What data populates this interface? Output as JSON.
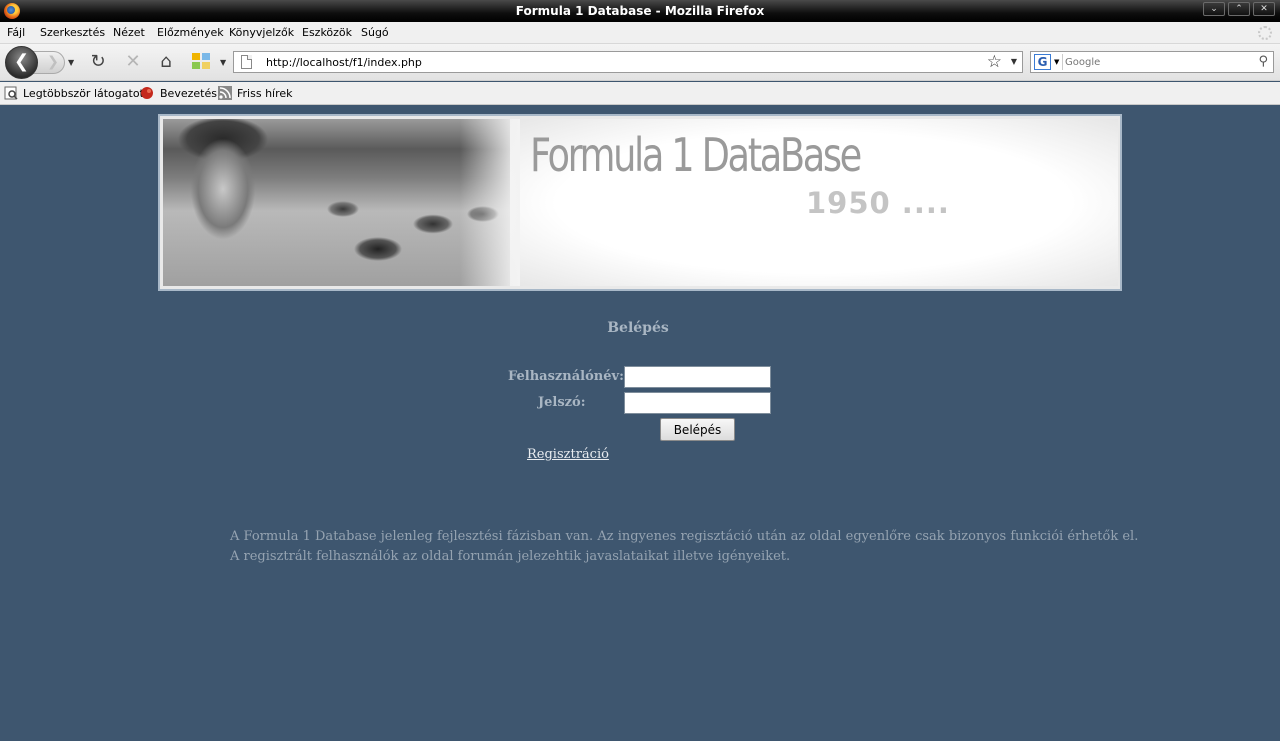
{
  "window": {
    "title": "Formula 1 Database - Mozilla Firefox",
    "controls": {
      "minimize": "⌄",
      "maximize": "⌃",
      "close": "✕"
    }
  },
  "menu": {
    "items": [
      "Fájl",
      "Szerkesztés",
      "Nézet",
      "Előzmények",
      "Könyvjelzők",
      "Eszközök",
      "Súgó"
    ]
  },
  "navigation": {
    "back_icon": "back-arrow-icon",
    "forward_icon": "forward-arrow-icon",
    "url": "http://localhost/f1/index.php",
    "search_placeholder": "Google",
    "search_engine_letter": "G"
  },
  "bookmarks": {
    "items": [
      "Legtöbbször látogatott",
      "Bevezetés",
      "Friss hírek"
    ]
  },
  "banner": {
    "headline": "Formula 1 DataBase",
    "year": "1950 ...."
  },
  "login": {
    "title": "Belépés",
    "username_label": "Felhasználónév:",
    "username_value": "",
    "password_label": "Jelszó:",
    "password_value": "",
    "submit_label": "Belépés",
    "register_link": "Regisztráció"
  },
  "info": {
    "line1": "A Formula 1 Database jelenleg fejlesztési fázisban van. Az ingyenes regisztáció után az oldal egyenlőre csak bizonyos funkciói érhetők el.",
    "line2": "A regisztrált felhasználók az oldal forumán jelezehtik javaslataikat illetve igényeiket."
  },
  "colors": {
    "page_background": "#3e566f",
    "label_text": "#a9b6c3",
    "info_text": "#95a3b1"
  }
}
